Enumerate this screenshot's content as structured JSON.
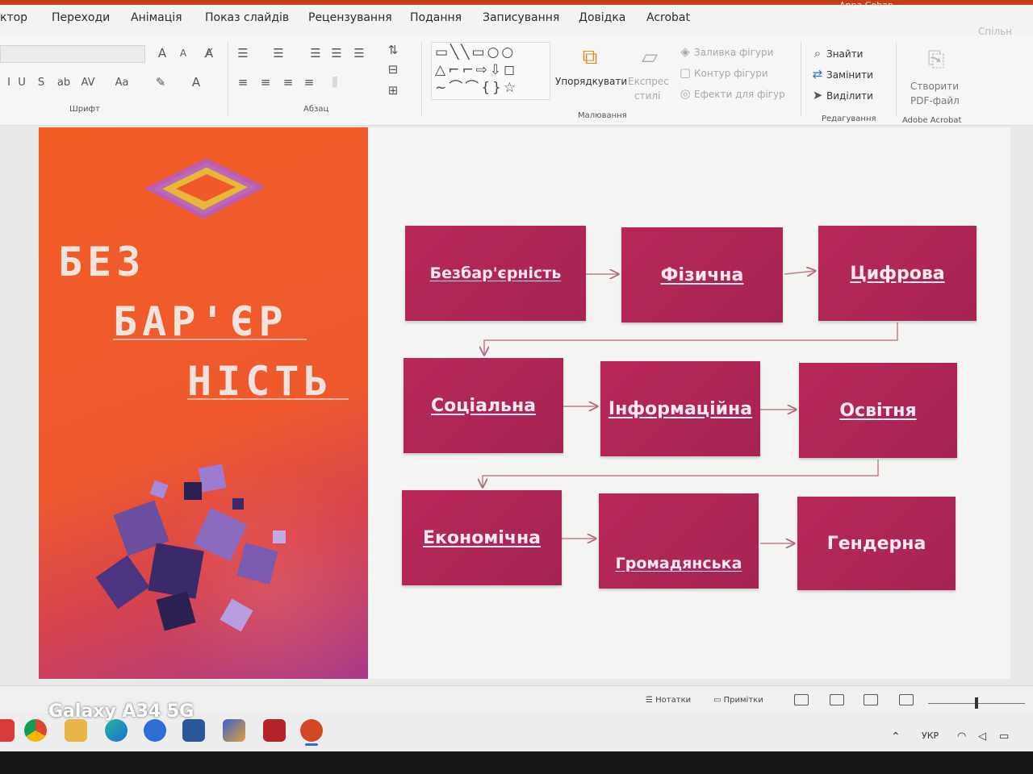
{
  "ribbon_tabs": [
    "ктор",
    "Переходи",
    "Анімація",
    "Показ слайдів",
    "Рецензування",
    "Подання",
    "Записування",
    "Довідка",
    "Acrobat"
  ],
  "ribbon_top_right": "Anna Cobap",
  "ribbon": {
    "share_label": "Спільн",
    "groups": {
      "font": "Шрифт",
      "paragraph": "Абзац",
      "drawing": "Малювання",
      "editing": "Редагування",
      "acrobat": "Adobe Acrobat"
    },
    "arrange_label": "Упорядкувати",
    "quick_styles_line1": "Експрес",
    "quick_styles_line2": "стилі",
    "shape_fill": "Заливка фігури",
    "shape_outline": "Контур фігури",
    "shape_effects": "Ефекти для фігур",
    "find": "Знайти",
    "replace": "Замінити",
    "select": "Виділити",
    "create_pdf_line1": "Створити",
    "create_pdf_line2": "PDF-файл"
  },
  "slide": {
    "title_lines": [
      "БЕЗ",
      "БАР'ЄР",
      "НІСТЬ"
    ],
    "boxes": [
      "Безбар'єрність",
      "Фізична",
      "Цифрова",
      "Соціальна",
      "Інформаційна",
      "Освітня",
      "Економічна",
      "Громадянська",
      "Гендерна"
    ]
  },
  "status_bar": {
    "notes": "Нотатки",
    "comments": "Примітки"
  },
  "taskbar": {
    "language": "УКР"
  },
  "watermark": "Galaxy A34 5G",
  "colors": {
    "accent": "#c43e1c",
    "box": "#b0255a",
    "slide_orange": "#f25d26",
    "slide_purple": "#a83a8a"
  }
}
